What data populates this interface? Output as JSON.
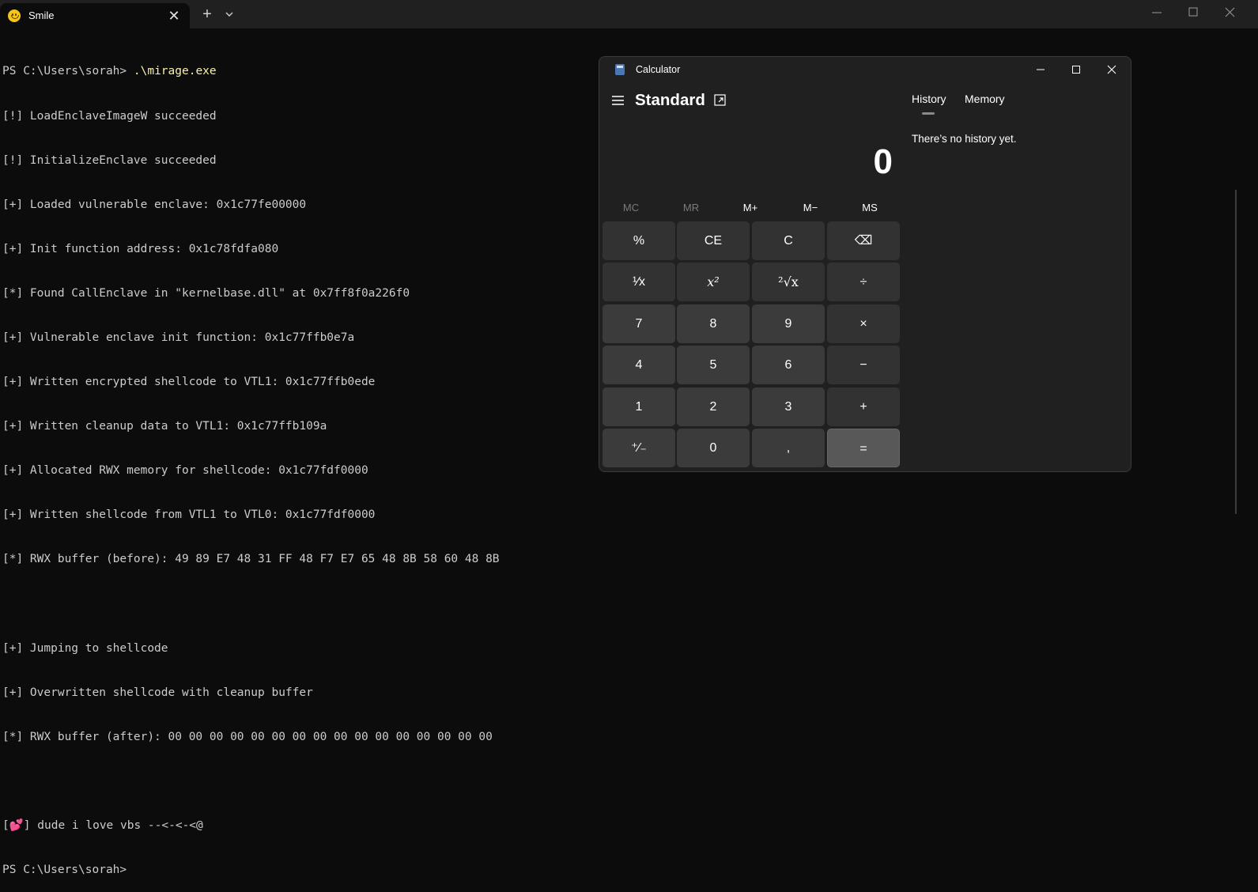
{
  "terminal_window": {
    "tab_title": "Smile",
    "tab_close": "✕",
    "new_tab": "+",
    "lines": [
      {
        "prompt": "PS C:\\Users\\sorah> ",
        "cmd": ".\\mirage.exe"
      },
      {
        "text": "[!] LoadEnclaveImageW succeeded"
      },
      {
        "text": "[!] InitializeEnclave succeeded"
      },
      {
        "text": "[+] Loaded vulnerable enclave: 0x1c77fe00000"
      },
      {
        "text": "[+] Init function address: 0x1c78fdfa080"
      },
      {
        "text": "[*] Found CallEnclave in \"kernelbase.dll\" at 0x7ff8f0a226f0"
      },
      {
        "text": "[+] Vulnerable enclave init function: 0x1c77ffb0e7a"
      },
      {
        "text": "[+] Written encrypted shellcode to VTL1: 0x1c77ffb0ede"
      },
      {
        "text": "[+] Written cleanup data to VTL1: 0x1c77ffb109a"
      },
      {
        "text": "[+] Allocated RWX memory for shellcode: 0x1c77fdf0000"
      },
      {
        "text": "[+] Written shellcode from VTL1 to VTL0: 0x1c77fdf0000"
      },
      {
        "text": "[*] RWX buffer (before): 49 89 E7 48 31 FF 48 F7 E7 65 48 8B 58 60 48 8B"
      },
      {
        "text": ""
      },
      {
        "text": "[+] Jumping to shellcode"
      },
      {
        "text": "[+] Overwritten shellcode with cleanup buffer"
      },
      {
        "text": "[*] RWX buffer (after): 00 00 00 00 00 00 00 00 00 00 00 00 00 00 00 00"
      },
      {
        "text": ""
      },
      {
        "pre": "[",
        "heart": "💕",
        "post": "] dude i love vbs --<-<-<@"
      },
      {
        "text": "PS C:\\Users\\sorah>"
      }
    ]
  },
  "calculator": {
    "title": "Calculator",
    "mode": "Standard",
    "display": "0",
    "memory_buttons": [
      {
        "label": "MC",
        "enabled": false
      },
      {
        "label": "MR",
        "enabled": false
      },
      {
        "label": "M+",
        "enabled": true
      },
      {
        "label": "M−",
        "enabled": true
      },
      {
        "label": "MS",
        "enabled": true
      }
    ],
    "keys": [
      [
        "%",
        "CE",
        "C",
        "⌫"
      ],
      [
        "¹⁄x",
        "x²",
        "²√x",
        "÷"
      ],
      [
        "7",
        "8",
        "9",
        "×"
      ],
      [
        "4",
        "5",
        "6",
        "−"
      ],
      [
        "1",
        "2",
        "3",
        "+"
      ],
      [
        "⁺⁄₋",
        "0",
        ",",
        "="
      ]
    ],
    "history_tab": "History",
    "memory_tab": "Memory",
    "history_empty": "There’s no history yet."
  }
}
